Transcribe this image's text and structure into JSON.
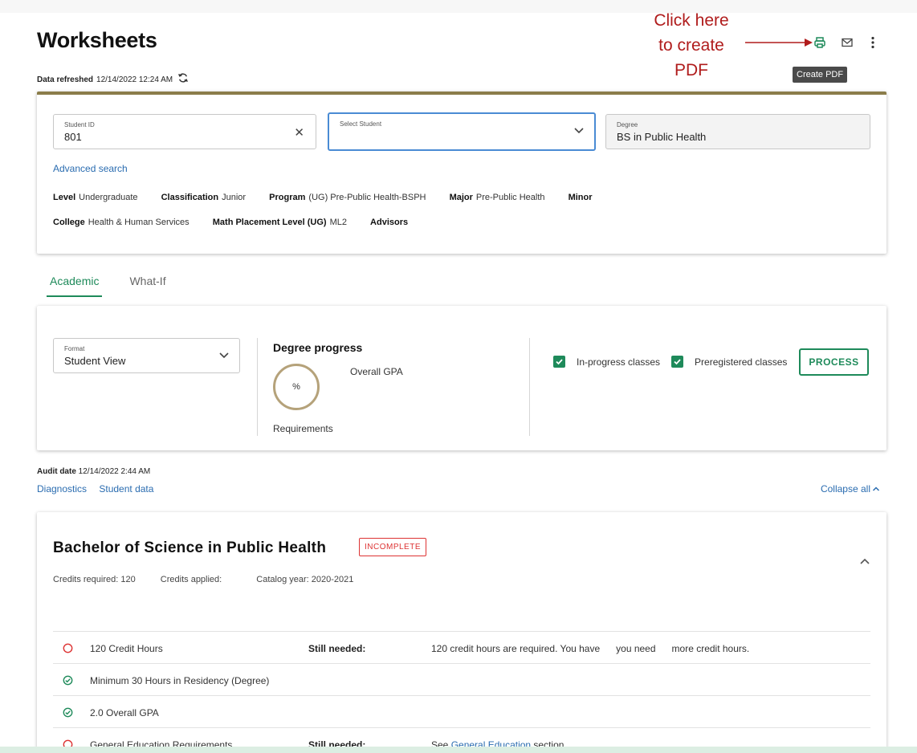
{
  "page": {
    "title": "Worksheets",
    "refreshed_label": "Data refreshed",
    "refreshed_value": "12/14/2022 12:24 AM"
  },
  "callout": {
    "line1": "Click here",
    "line2": "to create",
    "line3": "PDF",
    "color": "#b01c1c"
  },
  "toolbar": {
    "print_icon": "printer-icon",
    "email_icon": "envelope-icon",
    "more_icon": "more-vertical-icon",
    "tooltip": "Create PDF"
  },
  "student": {
    "id_label": "Student ID",
    "id_value": "801",
    "select_label": "Select Student",
    "select_value": "",
    "degree_label": "Degree",
    "degree_value": "BS in Public Health",
    "advanced_search": "Advanced search",
    "row1": [
      {
        "label": "Level",
        "value": "Undergraduate"
      },
      {
        "label": "Classification",
        "value": "Junior"
      },
      {
        "label": "Program",
        "value": "(UG) Pre-Public Health-BSPH"
      },
      {
        "label": "Major",
        "value": "Pre-Public Health"
      },
      {
        "label": "Minor",
        "value": ""
      }
    ],
    "row2": [
      {
        "label": "College",
        "value": "Health & Human Services"
      },
      {
        "label": "Math Placement Level (UG)",
        "value": "ML2"
      },
      {
        "label": "Advisors",
        "value": ""
      }
    ]
  },
  "tabs": [
    {
      "label": "Academic",
      "active": true
    },
    {
      "label": "What-If",
      "active": false
    }
  ],
  "academic": {
    "format_label": "Format",
    "format_value": "Student View",
    "progress_title": "Degree progress",
    "progress_percent": "%",
    "overall_gpa": "Overall GPA",
    "requirements": "Requirements",
    "inprogress_label": "In-progress classes",
    "preregistered_label": "Preregistered classes",
    "process_button": "PROCESS",
    "accent": "#1e8a5a"
  },
  "audit": {
    "date_label": "Audit date",
    "date_value": "12/14/2022 2:44 AM",
    "diagnostics": "Diagnostics",
    "student_data": "Student data",
    "collapse_all": "Collapse all"
  },
  "degree_block": {
    "title": "Bachelor of Science in Public Health",
    "status": "INCOMPLETE",
    "credits_required": "Credits required:  120",
    "credits_applied": "Credits applied:",
    "catalog_year": "Catalog year:  2020-2021",
    "rows": [
      {
        "status": "incomplete",
        "name": "120 Credit Hours",
        "still_needed": "Still needed:",
        "detail_pre": "120 credit hours are required. You have      you need      more credit hours.",
        "link": "",
        "detail_post": ""
      },
      {
        "status": "complete",
        "name": "Minimum 30 Hours in Residency (Degree)",
        "still_needed": "",
        "detail_pre": "",
        "link": "",
        "detail_post": ""
      },
      {
        "status": "complete",
        "name": "2.0 Overall GPA",
        "still_needed": "",
        "detail_pre": "",
        "link": "",
        "detail_post": ""
      },
      {
        "status": "incomplete",
        "name": "General Education Requirements",
        "still_needed": "Still needed:",
        "detail_pre": "See ",
        "link": "General Education",
        "detail_post": " section"
      }
    ]
  }
}
